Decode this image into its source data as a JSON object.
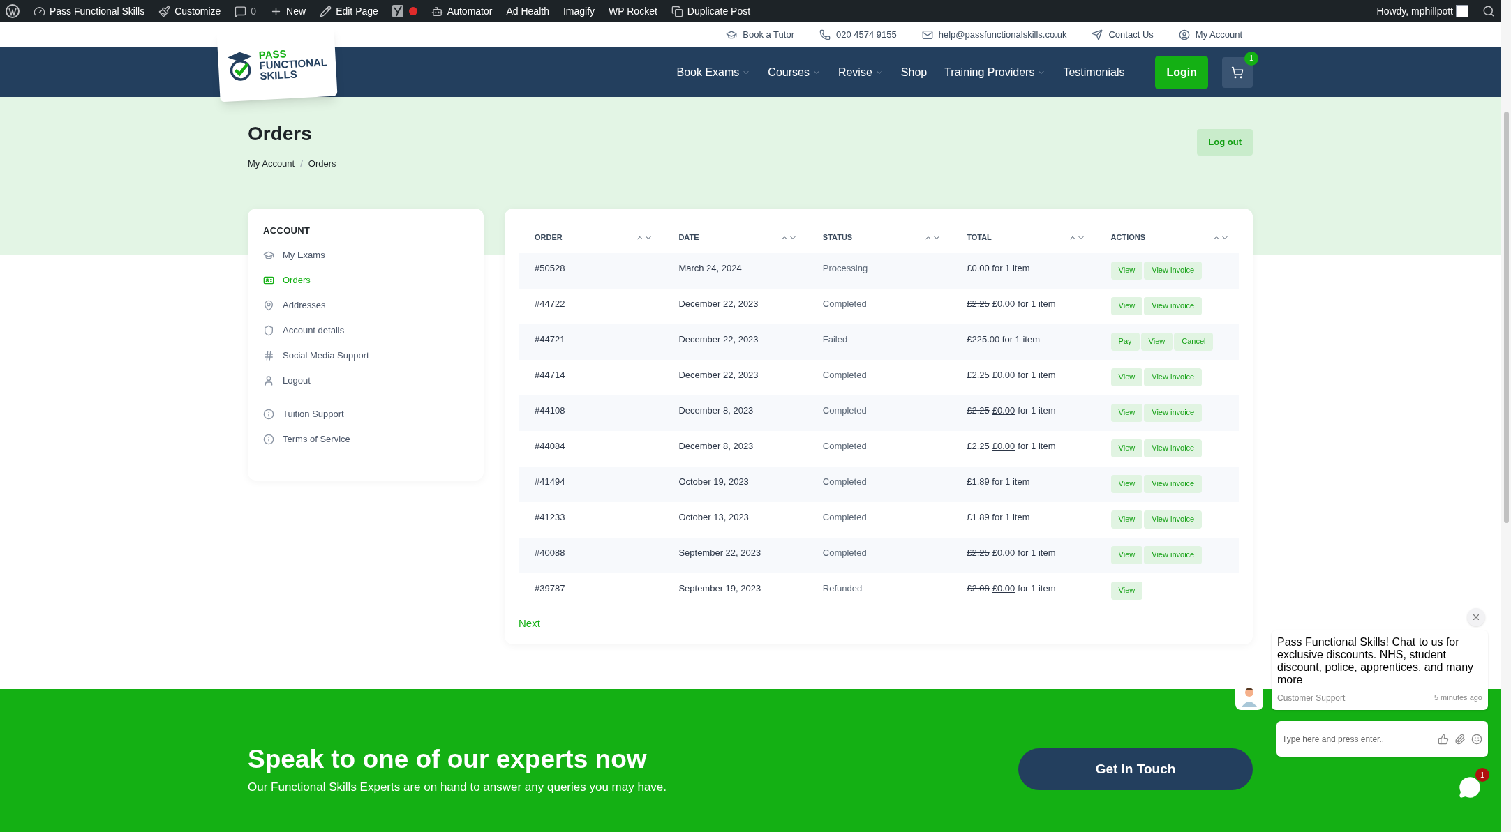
{
  "admin_bar": {
    "items": [
      {
        "label": "Pass Functional Skills"
      },
      {
        "label": "Customize"
      },
      {
        "label": "0"
      },
      {
        "label": "New"
      },
      {
        "label": "Edit Page"
      },
      {
        "kind": "seo",
        "color": "#e02b2b"
      },
      {
        "label": "Automator"
      },
      {
        "label": "Ad Health"
      },
      {
        "label": "Imagify"
      },
      {
        "label": "WP Rocket"
      },
      {
        "label": "Duplicate Post"
      }
    ],
    "greeting": "Howdy, mphillpott"
  },
  "top_links": [
    "Book a Tutor",
    "020 4574 9155",
    "help@passfunctionalskills.co.uk",
    "Contact Us",
    "My Account"
  ],
  "logo": {
    "lines": [
      "PASS",
      "FUNCTIONAL",
      "SKILLS"
    ]
  },
  "nav": {
    "items": [
      {
        "label": "Book Exams",
        "has_dropdown": true
      },
      {
        "label": "Courses",
        "has_dropdown": true
      },
      {
        "label": "Revise",
        "has_dropdown": true
      },
      {
        "label": "Shop",
        "has_dropdown": false
      },
      {
        "label": "Training Providers",
        "has_dropdown": true
      },
      {
        "label": "Testimonials",
        "has_dropdown": false
      }
    ],
    "login": "Login",
    "cart_count": "1"
  },
  "page": {
    "title": "Orders",
    "breadcrumb": [
      "My Account",
      "Orders"
    ],
    "breadcrumb_separator": "/",
    "logout": "Log out"
  },
  "sidebar": {
    "heading": "ACCOUNT",
    "groups": [
      [
        {
          "label": "My Exams",
          "selected": false
        },
        {
          "label": "Orders",
          "selected": true
        },
        {
          "label": "Addresses",
          "selected": false
        },
        {
          "label": "Account details",
          "selected": false
        },
        {
          "label": "Social Media Support",
          "selected": false
        },
        {
          "label": "Logout",
          "selected": false
        }
      ],
      [
        {
          "label": "Tuition Support",
          "selected": false
        },
        {
          "label": "Terms of Service",
          "selected": false
        }
      ]
    ]
  },
  "table": {
    "columns": [
      "ORDER",
      "DATE",
      "STATUS",
      "TOTAL",
      "ACTIONS"
    ],
    "rows": [
      {
        "order": "#50528",
        "date": "March 24, 2024",
        "status": "Processing",
        "total": {
          "kind": "plain",
          "text": "£0.00 for 1 item"
        },
        "actions": [
          "View",
          "View invoice"
        ]
      },
      {
        "order": "#44722",
        "date": "December 22, 2023",
        "status": "Completed",
        "total": {
          "kind": "discounted",
          "was": "£2.25",
          "now": "£0.00",
          "suffix": "for 1 item"
        },
        "actions": [
          "View",
          "View invoice"
        ]
      },
      {
        "order": "#44721",
        "date": "December 22, 2023",
        "status": "Failed",
        "total": {
          "kind": "plain",
          "text": "£225.00 for 1 item"
        },
        "actions": [
          "Pay",
          "View",
          "Cancel"
        ]
      },
      {
        "order": "#44714",
        "date": "December 22, 2023",
        "status": "Completed",
        "total": {
          "kind": "discounted",
          "was": "£2.25",
          "now": "£0.00",
          "suffix": "for 1 item"
        },
        "actions": [
          "View",
          "View invoice"
        ]
      },
      {
        "order": "#44108",
        "date": "December 8, 2023",
        "status": "Completed",
        "total": {
          "kind": "discounted",
          "was": "£2.25",
          "now": "£0.00",
          "suffix": "for 1 item"
        },
        "actions": [
          "View",
          "View invoice"
        ]
      },
      {
        "order": "#44084",
        "date": "December 8, 2023",
        "status": "Completed",
        "total": {
          "kind": "discounted",
          "was": "£2.25",
          "now": "£0.00",
          "suffix": "for 1 item"
        },
        "actions": [
          "View",
          "View invoice"
        ]
      },
      {
        "order": "#41494",
        "date": "October 19, 2023",
        "status": "Completed",
        "total": {
          "kind": "plain",
          "text": "£1.89 for 1 item"
        },
        "actions": [
          "View",
          "View invoice"
        ]
      },
      {
        "order": "#41233",
        "date": "October 13, 2023",
        "status": "Completed",
        "total": {
          "kind": "plain",
          "text": "£1.89 for 1 item"
        },
        "actions": [
          "View",
          "View invoice"
        ]
      },
      {
        "order": "#40088",
        "date": "September 22, 2023",
        "status": "Completed",
        "total": {
          "kind": "discounted",
          "was": "£2.25",
          "now": "£0.00",
          "suffix": "for 1 item"
        },
        "actions": [
          "View",
          "View invoice"
        ]
      },
      {
        "order": "#39787",
        "date": "September 19, 2023",
        "status": "Refunded",
        "total": {
          "kind": "discounted",
          "was": "£2.08",
          "now": "£0.00",
          "suffix": "for 1 item"
        },
        "actions": [
          "View"
        ]
      }
    ],
    "next": "Next"
  },
  "cta": {
    "heading": "Speak to one of our experts now",
    "text": "Our Functional Skills Experts are on hand to answer any queries you may have.",
    "button": "Get In Touch"
  },
  "chat": {
    "message": "Pass Functional Skills! Chat to us for exclusive discounts. NHS, student discount, police, apprentices, and many more",
    "sender": "Customer Support",
    "time": "5 minutes ago",
    "placeholder": "Type here and press enter..",
    "badge": "1"
  }
}
